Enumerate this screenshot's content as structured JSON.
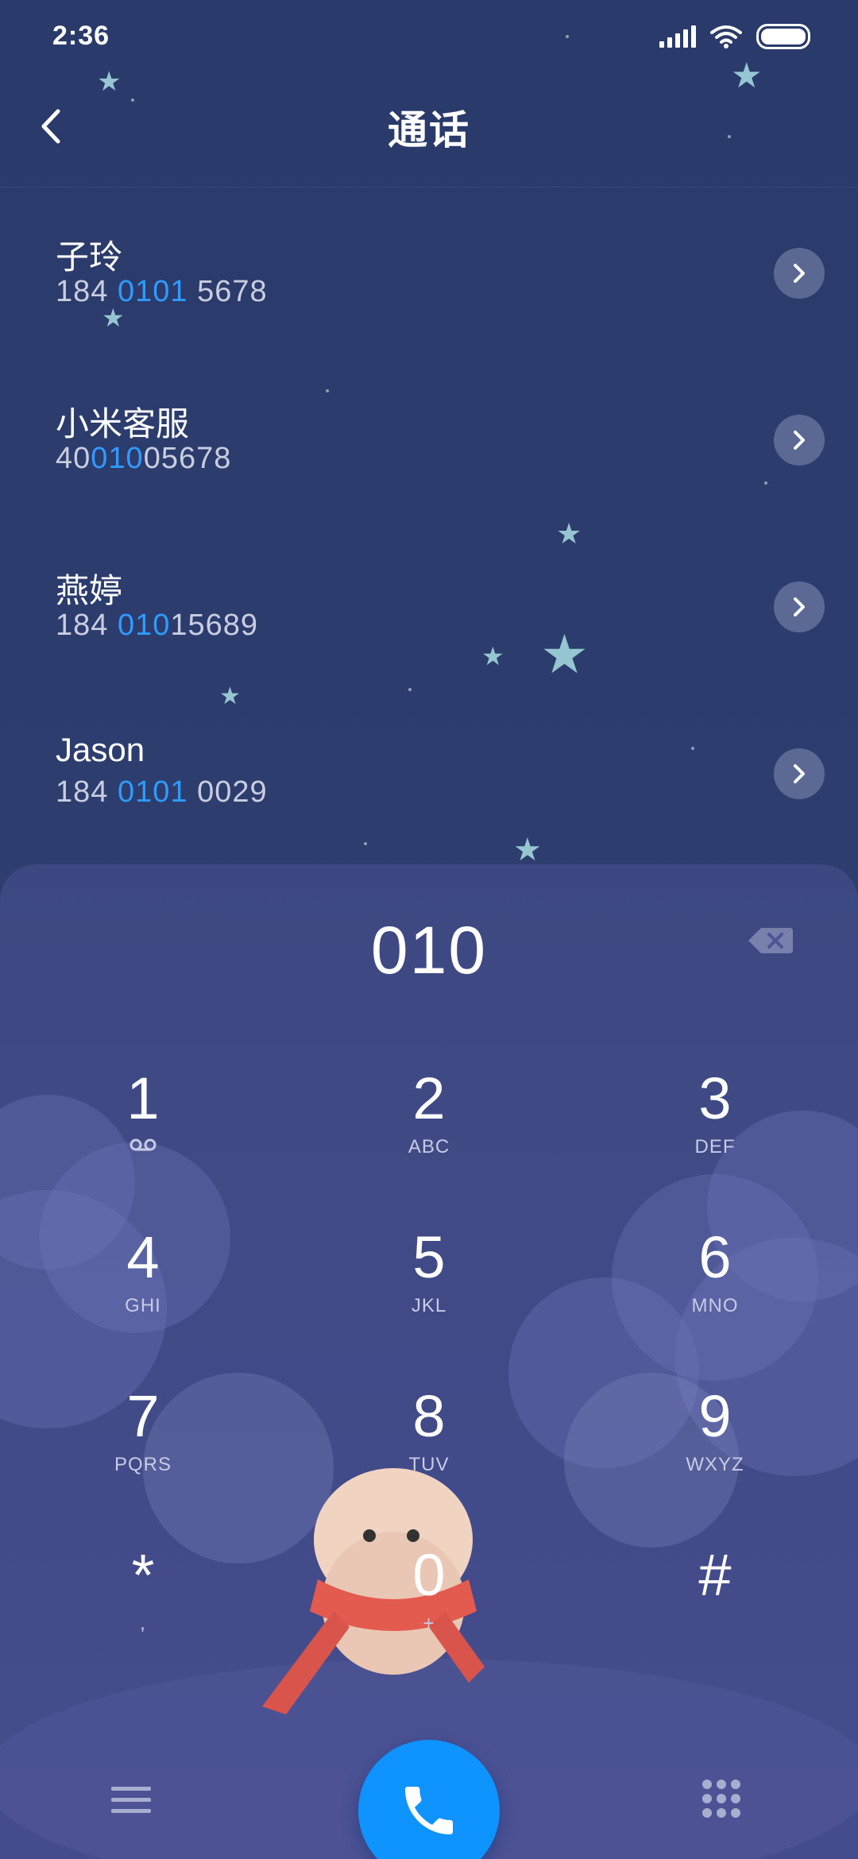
{
  "status": {
    "time": "2:36"
  },
  "header": {
    "title": "通话"
  },
  "results": [
    {
      "name": "子玲",
      "pre": "184 ",
      "match": "0101",
      "post": " 5678"
    },
    {
      "name": "小米客服",
      "pre": "40",
      "match": "010",
      "post": "05678"
    },
    {
      "name": "燕婷",
      "pre": "184 ",
      "match": "010",
      "post": "15689"
    },
    {
      "name": "Jason",
      "pre": "184 ",
      "match": "0101",
      "post": " 0029"
    }
  ],
  "dialer": {
    "entry": "010",
    "keys": [
      {
        "digit": "1",
        "sub": ""
      },
      {
        "digit": "2",
        "sub": "ABC"
      },
      {
        "digit": "3",
        "sub": "DEF"
      },
      {
        "digit": "4",
        "sub": "GHI"
      },
      {
        "digit": "5",
        "sub": "JKL"
      },
      {
        "digit": "6",
        "sub": "MNO"
      },
      {
        "digit": "7",
        "sub": "PQRS"
      },
      {
        "digit": "8",
        "sub": "TUV"
      },
      {
        "digit": "9",
        "sub": "WXYZ"
      },
      {
        "digit": "*",
        "sub": ","
      },
      {
        "digit": "0",
        "sub": "+"
      },
      {
        "digit": "#",
        "sub": ""
      }
    ]
  },
  "colors": {
    "accent": "#0f93ff",
    "highlight": "#2f9bff",
    "background": "#2d3d6e"
  },
  "icons": {
    "back": "chevron-left-icon",
    "row_action": "chevron-right-icon",
    "delete": "backspace-icon",
    "voicemail": "voicemail-icon",
    "menu": "menu-icon",
    "call": "phone-icon",
    "keypad": "dialpad-icon"
  }
}
